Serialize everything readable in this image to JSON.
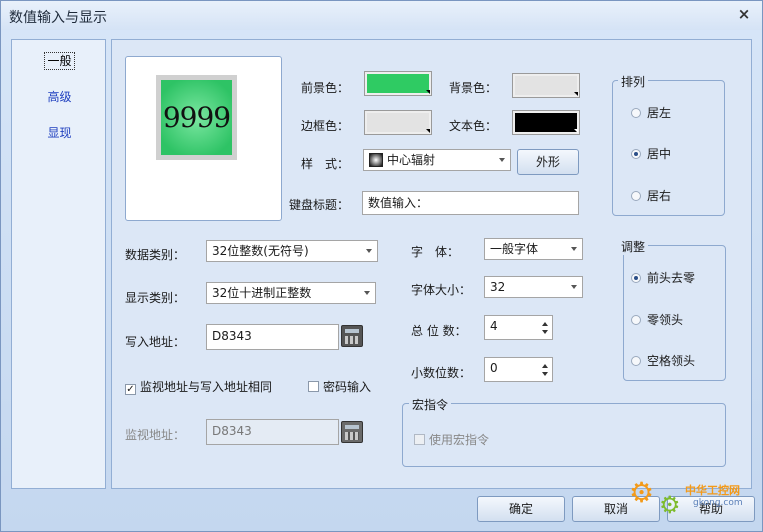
{
  "window": {
    "title": "数值输入与显示",
    "close": "×"
  },
  "nav": {
    "items": [
      "一般",
      "高级",
      "显现"
    ]
  },
  "preview": {
    "value": "9999"
  },
  "colors": {
    "foreground_label": "前景色：",
    "background_label": "背景色：",
    "border_label": "边框色：",
    "text_label": "文本色：",
    "foreground": "#2fcb63",
    "background": "#e3e3e3",
    "border": "#e3e3e3",
    "text": "#000000"
  },
  "style": {
    "label": "样　式：",
    "value": "中心辐射",
    "shape_button": "外形"
  },
  "keypad": {
    "label": "键盘标题：",
    "value": "数值输入："
  },
  "data_type": {
    "label": "数据类别：",
    "value": "32位整数(无符号)"
  },
  "display_type": {
    "label": "显示类别：",
    "value": "32位十进制正整数"
  },
  "write_addr": {
    "label": "写入地址：",
    "value": "D8343"
  },
  "options": {
    "same_addr": "监视地址与写入地址相同",
    "same_addr_checked": "✓",
    "password": "密码输入"
  },
  "monitor_addr": {
    "label": "监视地址：",
    "value": "D8343"
  },
  "font": {
    "label": "字　体：",
    "value": "一般字体"
  },
  "font_size": {
    "label": "字体大小：",
    "value": "32"
  },
  "total_digits": {
    "label": "总 位 数：",
    "value": "4"
  },
  "decimals": {
    "label": "小数位数：",
    "value": "0"
  },
  "align_group": {
    "title": "排列",
    "options": [
      "居左",
      "居中",
      "居右"
    ],
    "selected": "居中"
  },
  "adjust_group": {
    "title": "调整",
    "options": [
      "前头去零",
      "零领头",
      "空格领头"
    ],
    "selected": "前头去零"
  },
  "macro_group": {
    "title": "宏指令",
    "use_macro": "使用宏指令"
  },
  "buttons": {
    "ok": "确定",
    "cancel": "取消",
    "help": "帮助"
  },
  "watermark": {
    "cn": "中华工控网",
    "url": "gkong.com"
  }
}
